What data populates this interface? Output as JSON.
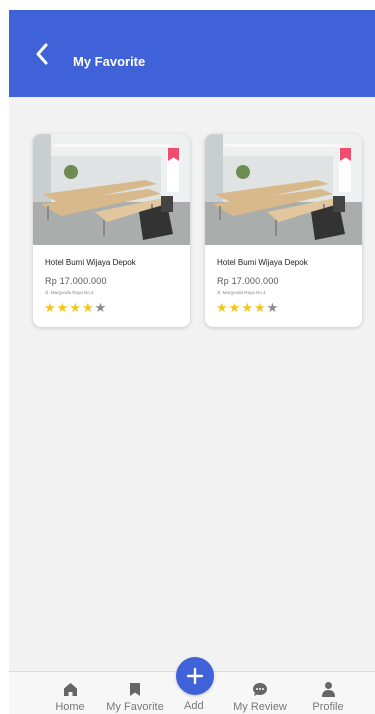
{
  "colors": {
    "primary": "#4062d8",
    "bookmark": "#ef4d6b",
    "star_filled": "#f5c518",
    "star_empty": "#8a8a8a",
    "nav_icon": "#666666"
  },
  "header": {
    "back_icon": "chevron-left-icon",
    "title": "My Favorite"
  },
  "favorites": [
    {
      "name": "Hotel Bumi Wijaya Depok",
      "price": "Rp 17.000.000",
      "address": "Jl. Margonda Raya No.4",
      "rating": 4,
      "max_rating": 5,
      "bookmark_icon": "bookmark-icon"
    },
    {
      "name": "Hotel Bumi Wijaya Depok",
      "price": "Rp 17.000.000",
      "address": "Jl. Margonda Raya No.4",
      "rating": 4,
      "max_rating": 5,
      "bookmark_icon": "bookmark-icon"
    }
  ],
  "nav": {
    "items": [
      {
        "label": "Home",
        "icon": "home-icon"
      },
      {
        "label": "My Favorite",
        "icon": "bookmark-icon"
      },
      {
        "label": "Add",
        "icon": "plus-icon"
      },
      {
        "label": "My Review",
        "icon": "chat-icon"
      },
      {
        "label": "Profile",
        "icon": "user-icon"
      }
    ]
  }
}
